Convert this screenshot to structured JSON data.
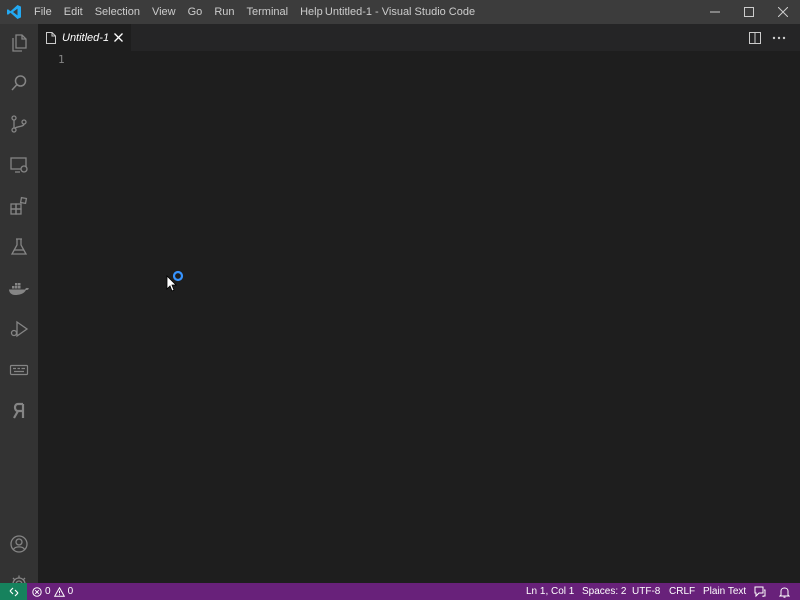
{
  "menu": [
    "File",
    "Edit",
    "Selection",
    "View",
    "Go",
    "Run",
    "Terminal",
    "Help"
  ],
  "window": {
    "title": "Untitled-1 - Visual Studio Code"
  },
  "tab": {
    "label": "Untitled-1"
  },
  "editor": {
    "line_number": "1"
  },
  "activity": {
    "icons": [
      "explorer-icon",
      "search-icon",
      "source-control-icon",
      "remote-explorer-icon",
      "extensions-icon",
      "testing-icon",
      "docker-icon",
      "run-debug-icon",
      "keyboard-icon",
      "ya-icon",
      "accounts-icon",
      "settings-gear-icon"
    ]
  },
  "status": {
    "errors": "0",
    "warnings": "0",
    "position": "Ln 1, Col 1",
    "spaces": "Spaces: 2",
    "encoding": "UTF-8",
    "eol": "CRLF",
    "language": "Plain Text"
  },
  "colors": {
    "titlebar": "#3c3c3c",
    "activitybar": "#333333",
    "editor": "#1e1e1e",
    "statusbar": "#68217a",
    "remote": "#16825d",
    "accent": "#3794ff"
  }
}
